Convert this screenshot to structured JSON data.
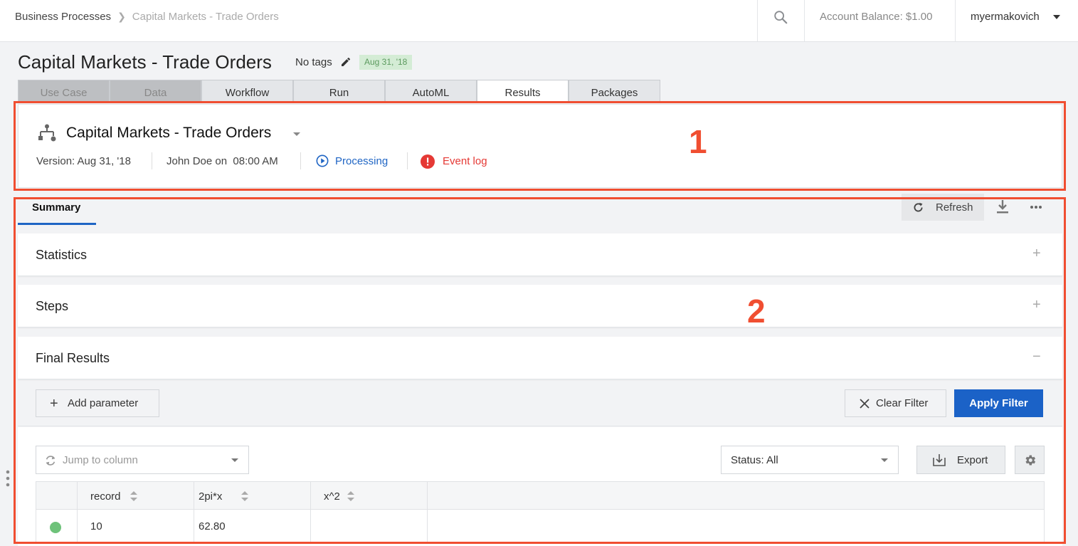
{
  "topbar": {
    "breadcrumb": [
      "Business Processes",
      "Capital Markets - Trade Orders"
    ],
    "account_balance": "Account Balance: $1.00",
    "username": "myermakovich"
  },
  "page": {
    "title": "Capital Markets - Trade Orders",
    "tags": "No tags",
    "date_badge": "Aug 31, '18"
  },
  "tabs": [
    {
      "label": "Use Case",
      "state": "disabled"
    },
    {
      "label": "Data",
      "state": "disabled"
    },
    {
      "label": "Workflow",
      "state": "normal"
    },
    {
      "label": "Run",
      "state": "normal"
    },
    {
      "label": "AutoML",
      "state": "normal"
    },
    {
      "label": "Results",
      "state": "active"
    },
    {
      "label": "Packages",
      "state": "normal"
    }
  ],
  "version_card": {
    "title": "Capital Markets - Trade Orders",
    "version": "Version: Aug 31, '18",
    "author": "John Doe on  08:00 AM",
    "status": "Processing",
    "event_log": "Event log"
  },
  "callouts": [
    "1",
    "2"
  ],
  "summary": {
    "tab": "Summary",
    "refresh": "Refresh"
  },
  "panels": [
    {
      "title": "Statistics",
      "sign": "+"
    },
    {
      "title": "Steps",
      "sign": "+"
    },
    {
      "title": "Final Results",
      "sign": "−"
    }
  ],
  "filters": {
    "add_parameter": "Add parameter",
    "clear_filter": "Clear Filter",
    "apply_filter": "Apply Filter"
  },
  "table_controls": {
    "jump_placeholder": "Jump to column",
    "status_select": "Status: All",
    "export": "Export"
  },
  "table": {
    "columns": [
      "record",
      "2pi*x",
      "x^2"
    ],
    "rows": [
      {
        "record": "10",
        "2pi_x": "62.80",
        "x2": ""
      }
    ]
  },
  "colors": {
    "accent": "#1b62c7",
    "callout": "#f04e31",
    "error": "#e53935",
    "status_ok": "#6ec27a"
  }
}
